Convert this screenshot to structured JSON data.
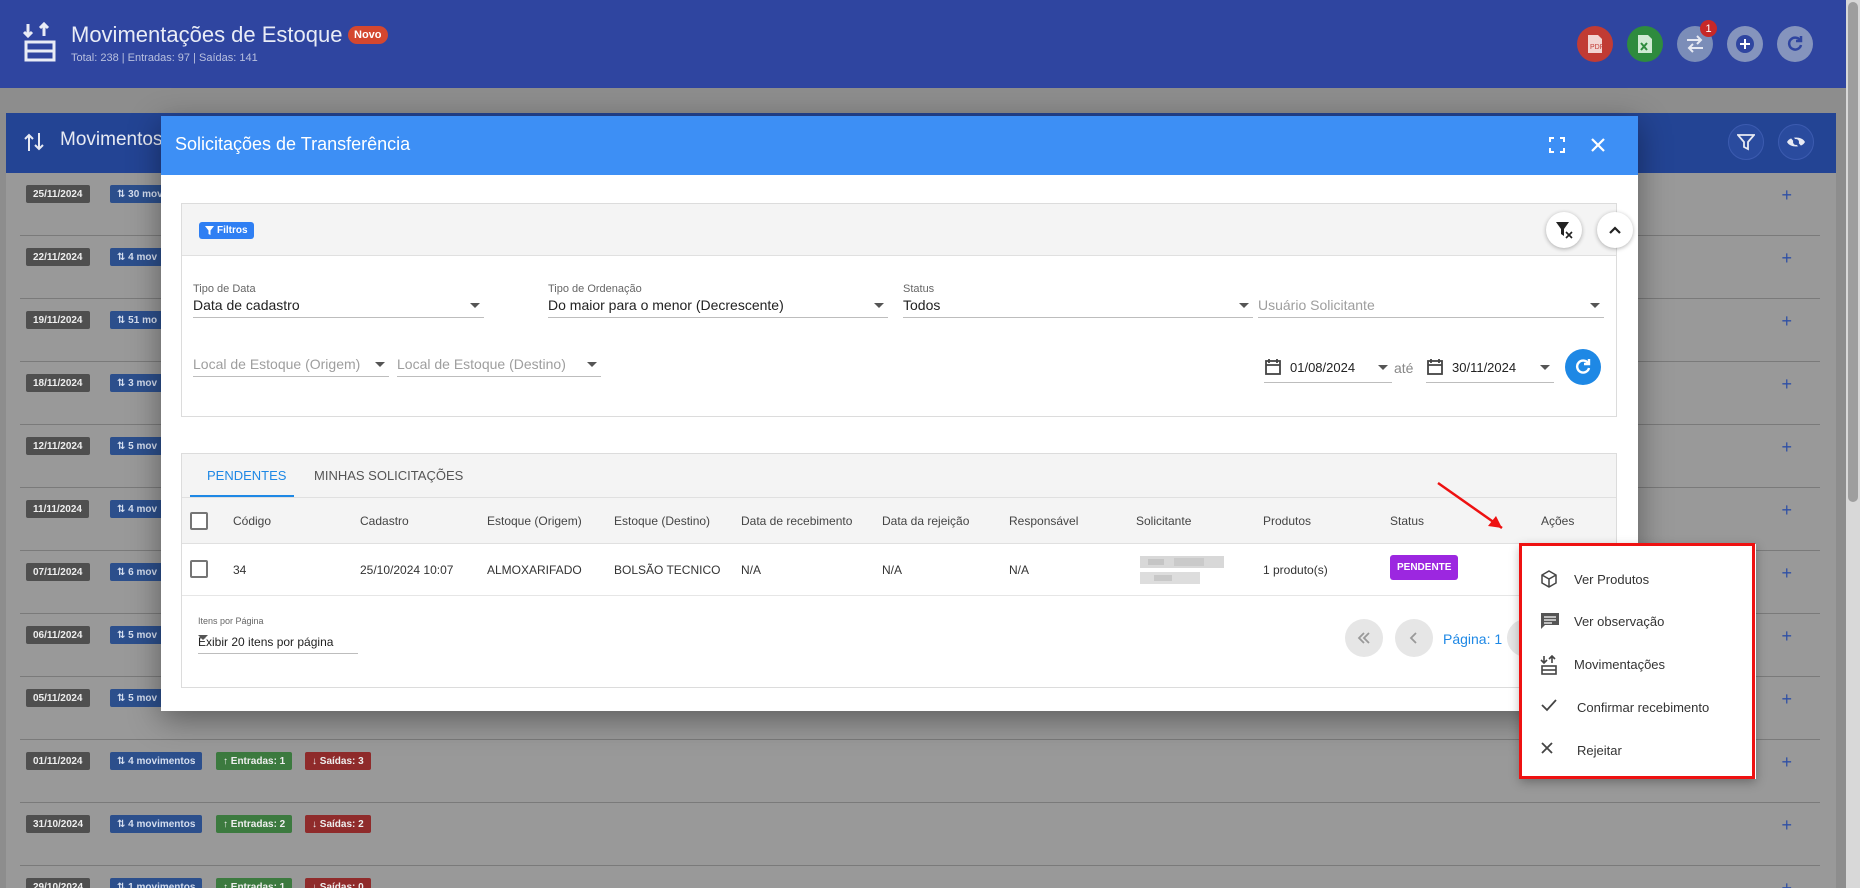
{
  "app": {
    "title": "Movimentações de Estoque",
    "badge": "Novo",
    "subtitle": "Total: 238 | Entradas: 97 | Saídas: 141",
    "notification_count": "1"
  },
  "panel": {
    "title": "Movimentos"
  },
  "rows": [
    {
      "date": "25/11/2024",
      "mov": "30 mov"
    },
    {
      "date": "22/11/2024",
      "mov": "4 mov"
    },
    {
      "date": "19/11/2024",
      "mov": "51 mo"
    },
    {
      "date": "18/11/2024",
      "mov": "3 mov"
    },
    {
      "date": "12/11/2024",
      "mov": "5 mov"
    },
    {
      "date": "11/11/2024",
      "mov": "4 mov"
    },
    {
      "date": "07/11/2024",
      "mov": "6 mov"
    },
    {
      "date": "06/11/2024",
      "mov": "5 mov"
    },
    {
      "date": "05/11/2024",
      "mov": "5 mov"
    },
    {
      "date": "01/11/2024",
      "mov": "4 movimentos",
      "in": "Entradas: 1",
      "out": "Saídas: 3"
    },
    {
      "date": "31/10/2024",
      "mov": "4 movimentos",
      "in": "Entradas: 2",
      "out": "Saídas: 2"
    },
    {
      "date": "29/10/2024",
      "mov": "1 movimentos",
      "in": "Entradas: 1",
      "out": "Saídas: 0"
    }
  ],
  "modal": {
    "title": "Solicitações de Transferência",
    "filters_tag": "Filtros",
    "tipo_data": {
      "label": "Tipo de Data",
      "value": "Data de cadastro"
    },
    "tipo_ordenacao": {
      "label": "Tipo de Ordenação",
      "value": "Do maior para o menor (Decrescente)"
    },
    "status": {
      "label": "Status",
      "value": "Todos"
    },
    "usuario": {
      "placeholder": "Usuário Solicitante"
    },
    "origem": {
      "placeholder": "Local de Estoque (Origem)"
    },
    "destino": {
      "placeholder": "Local de Estoque (Destino)"
    },
    "date_from": "01/08/2024",
    "ate": "até",
    "date_to": "30/11/2024",
    "tabs": [
      "PENDENTES",
      "MINHAS SOLICITAÇÕES"
    ],
    "columns": [
      "Código",
      "Cadastro",
      "Estoque (Origem)",
      "Estoque (Destino)",
      "Data de recebimento",
      "Data da rejeição",
      "Responsável",
      "Solicitante",
      "Produtos",
      "Status",
      "Ações"
    ],
    "row": {
      "codigo": "34",
      "cadastro": "25/10/2024 10:07",
      "origem": "ALMOXARIFADO",
      "destino": "BOLSÃO TECNICO",
      "recebimento": "N/A",
      "rejeicao": "N/A",
      "responsavel": "N/A",
      "produtos": "1 produto(s)",
      "status": "PENDENTE"
    },
    "pager": {
      "label": "Itens por Página",
      "value": "Exibir 20 itens por página",
      "page_text": "Página: 1"
    }
  },
  "context_menu": [
    {
      "label": "Ver Produtos",
      "icon": "box-icon"
    },
    {
      "label": "Ver observação",
      "icon": "comment-icon"
    },
    {
      "label": "Movimentações",
      "icon": "movements-icon"
    },
    {
      "label": "Confirmar recebimento",
      "icon": "check-icon"
    },
    {
      "label": "Rejeitar",
      "icon": "x-icon"
    }
  ],
  "colors": {
    "topbar": "#2f45a0",
    "modal_header": "#3d8ff5",
    "accent": "#1e88e5",
    "status_pending": "#9c27e0",
    "highlight": "#ee1111"
  }
}
